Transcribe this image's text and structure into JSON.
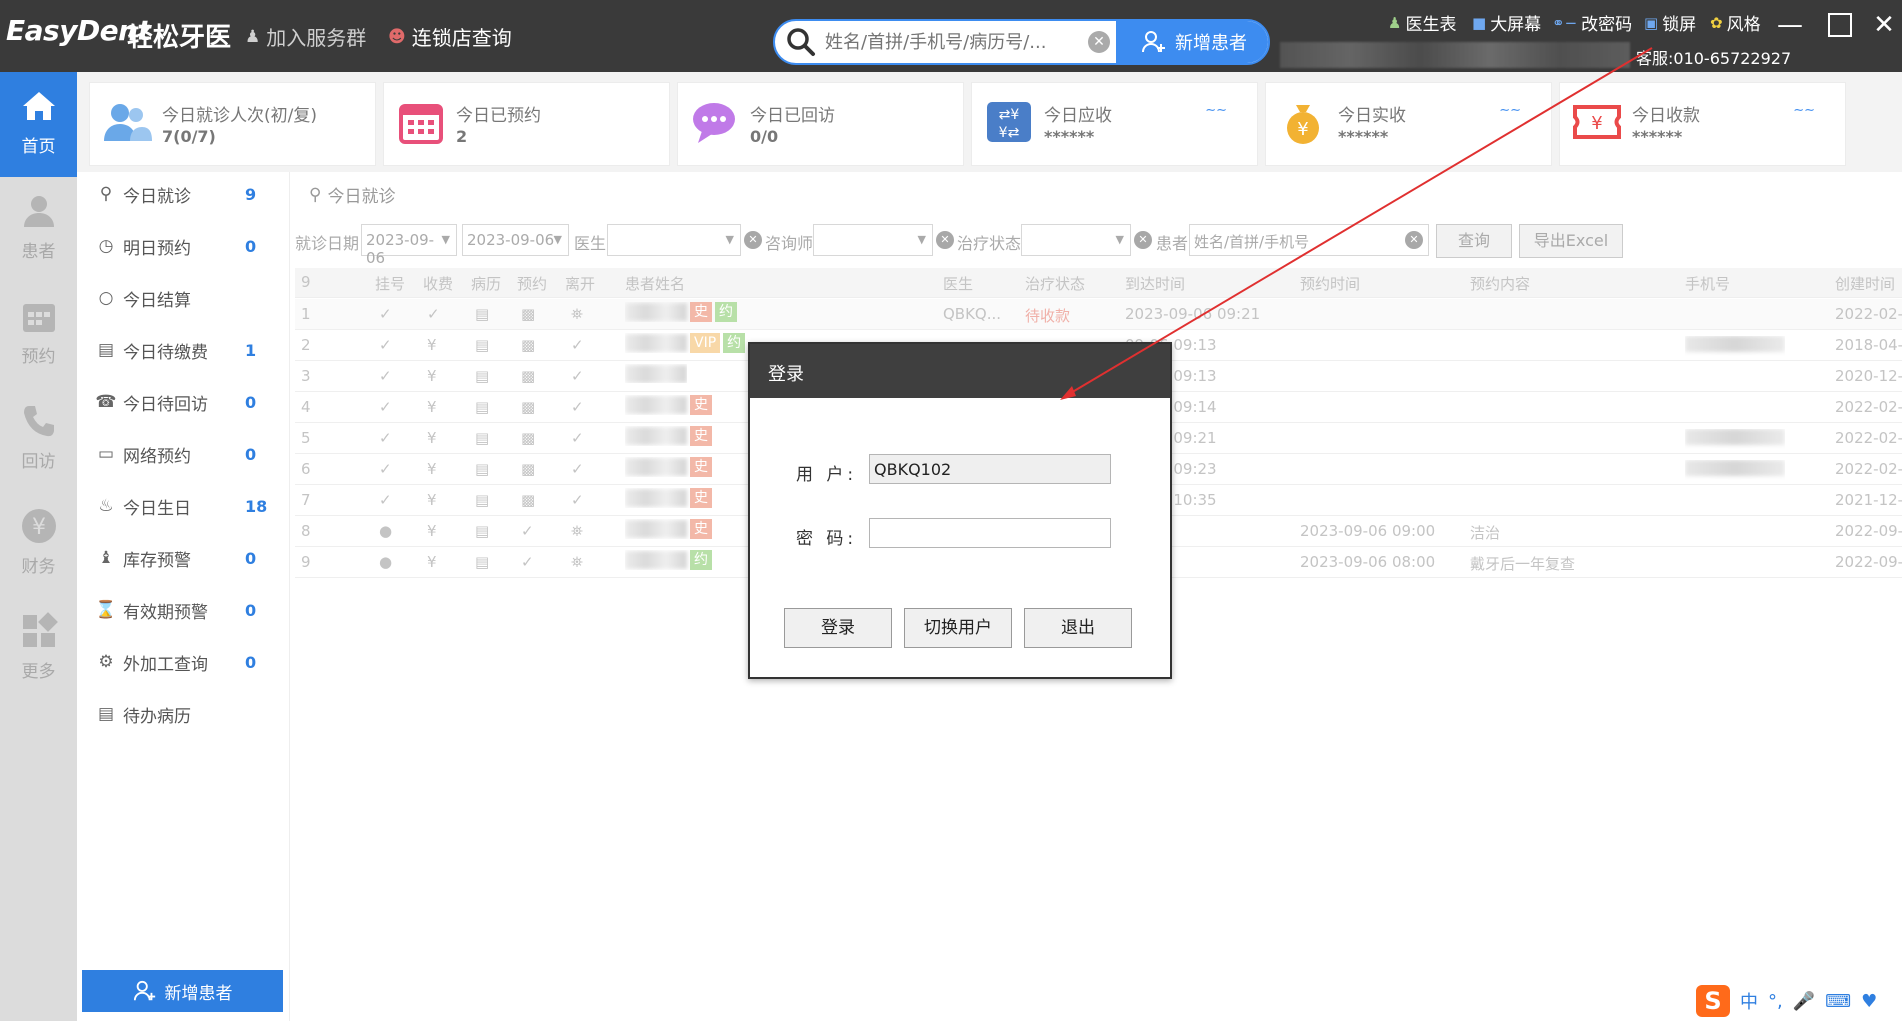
{
  "topbar": {
    "logo": "EasyDent",
    "logo_cn": "轻松牙医",
    "join_group": "加入服务群",
    "chain_query": "连锁店查询",
    "search_placeholder": "姓名/首拼/手机号/病历号/...",
    "new_patient": "新增患者",
    "right_items": [
      "医生表",
      "大屏幕",
      "改密码",
      "锁屏",
      "风格"
    ],
    "service": "客服:010-65722927"
  },
  "nav": [
    {
      "label": "首页",
      "icon": "home-icon",
      "active": true
    },
    {
      "label": "患者",
      "icon": "patient-icon",
      "active": false
    },
    {
      "label": "预约",
      "icon": "calendar-icon",
      "active": false
    },
    {
      "label": "回访",
      "icon": "phone-icon",
      "active": false
    },
    {
      "label": "财务",
      "icon": "yen-icon",
      "active": false
    },
    {
      "label": "更多",
      "icon": "grid-icon",
      "active": false
    }
  ],
  "stats": [
    {
      "title": "今日就诊人次(初/复)",
      "value": "7(0/7)",
      "icon": "users-icon"
    },
    {
      "title": "今日已预约",
      "value": "2",
      "icon": "calendar-icon"
    },
    {
      "title": "今日已回访",
      "value": "0/0",
      "icon": "chat-icon"
    },
    {
      "title": "今日应收",
      "value": "******",
      "icon": "transfer-icon"
    },
    {
      "title": "今日实收",
      "value": "******",
      "icon": "money-bag-icon"
    },
    {
      "title": "今日收款",
      "value": "******",
      "icon": "receipt-icon"
    }
  ],
  "sidebar": [
    {
      "label": "今日就诊",
      "count": "9",
      "icon": "visit-icon"
    },
    {
      "label": "明日预约",
      "count": "0",
      "icon": "clock-icon"
    },
    {
      "label": "今日结算",
      "count": "",
      "icon": "yen-circle-icon"
    },
    {
      "label": "今日待缴费",
      "count": "1",
      "icon": "bill-icon"
    },
    {
      "label": "今日待回访",
      "count": "0",
      "icon": "callback-icon"
    },
    {
      "label": "网络预约",
      "count": "0",
      "icon": "monitor-icon"
    },
    {
      "label": "今日生日",
      "count": "18",
      "icon": "cake-icon"
    },
    {
      "label": "库存预警",
      "count": "0",
      "icon": "stock-icon"
    },
    {
      "label": "有效期预警",
      "count": "0",
      "icon": "expiry-icon"
    },
    {
      "label": "外加工查询",
      "count": "0",
      "icon": "tooth-icon"
    },
    {
      "label": "待办病历",
      "count": "",
      "icon": "record-icon"
    }
  ],
  "new_patient_button": "新增患者",
  "main": {
    "title": "今日就诊",
    "filters": {
      "date_label": "就诊日期",
      "date_from": "2023-09-06",
      "date_to": "2023-09-06",
      "doctor_label": "医生",
      "consultant_label": "咨询师",
      "status_label": "治疗状态",
      "patient_label": "患者",
      "patient_placeholder": "姓名/首拼/手机号",
      "query": "查询",
      "export": "导出Excel"
    },
    "columns": [
      "9",
      "挂号",
      "收费",
      "病历",
      "预约",
      "离开",
      "患者姓名",
      "医生",
      "治疗状态",
      "到达时间",
      "预约时间",
      "预约内容",
      "手机号",
      "创建时间"
    ],
    "rows": [
      {
        "no": "1",
        "tags": [
          "史",
          "约"
        ],
        "doctor": "QBKQ...",
        "status": "待收款",
        "arrive": "2023-09-06 09:21",
        "appt_time": "",
        "appt_content": "",
        "created": "2022-02-"
      },
      {
        "no": "2",
        "tags": [
          "VIP",
          "约"
        ],
        "doctor": "",
        "status": "",
        "arrive": "09-06 09:13",
        "appt_time": "",
        "appt_content": "",
        "created": "2018-04-"
      },
      {
        "no": "3",
        "tags": [],
        "doctor": "",
        "status": "",
        "arrive": "09-06 09:13",
        "appt_time": "",
        "appt_content": "",
        "created": "2020-12-"
      },
      {
        "no": "4",
        "tags": [
          "史"
        ],
        "doctor": "",
        "status": "",
        "arrive": "09-06 09:14",
        "appt_time": "",
        "appt_content": "",
        "created": "2022-02-"
      },
      {
        "no": "5",
        "tags": [
          "史"
        ],
        "doctor": "",
        "status": "",
        "arrive": "09-06 09:21",
        "appt_time": "",
        "appt_content": "",
        "created": "2022-02-"
      },
      {
        "no": "6",
        "tags": [
          "史"
        ],
        "doctor": "",
        "status": "",
        "arrive": "09-06 09:23",
        "appt_time": "",
        "appt_content": "",
        "created": "2022-02-"
      },
      {
        "no": "7",
        "tags": [
          "史"
        ],
        "doctor": "",
        "status": "",
        "arrive": "09-06 10:35",
        "appt_time": "",
        "appt_content": "",
        "created": "2021-12-"
      },
      {
        "no": "8",
        "tags": [
          "史"
        ],
        "doctor": "",
        "status": "",
        "arrive": "",
        "appt_time": "2023-09-06 09:00",
        "appt_content": "洁治",
        "created": "2022-09-"
      },
      {
        "no": "9",
        "tags": [
          "约"
        ],
        "doctor": "",
        "status": "",
        "arrive": "",
        "appt_time": "2023-09-06 08:00",
        "appt_content": "戴牙后一年复查",
        "created": "2022-09-"
      }
    ]
  },
  "login_dialog": {
    "title": "登录",
    "user_label": "用 户:",
    "user_value": "QBKQ102",
    "password_label": "密 码:",
    "password_value": "",
    "login": "登录",
    "switch_user": "切换用户",
    "exit": "退出"
  },
  "ime": {
    "lang": "中"
  },
  "colors": {
    "accent": "#2f7fe0",
    "topbar": "#3a3a3a",
    "arrow": "#e03030"
  }
}
